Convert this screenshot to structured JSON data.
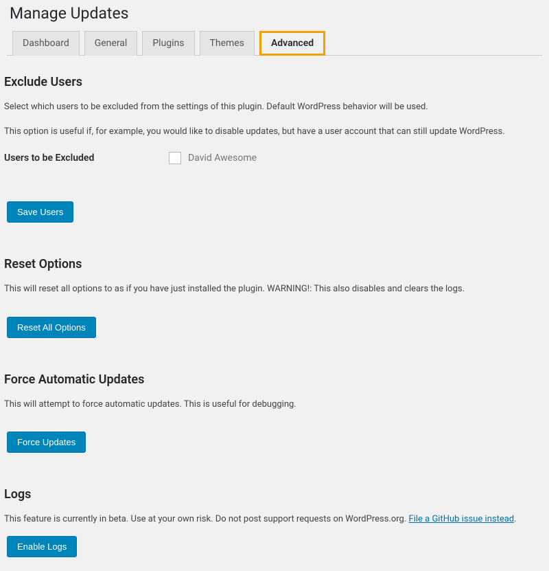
{
  "pageTitle": "Manage Updates",
  "tabs": [
    {
      "label": "Dashboard"
    },
    {
      "label": "General"
    },
    {
      "label": "Plugins"
    },
    {
      "label": "Themes"
    },
    {
      "label": "Advanced"
    }
  ],
  "excludeUsers": {
    "heading": "Exclude Users",
    "desc1": "Select which users to be excluded from the settings of this plugin. Default WordPress behavior will be used.",
    "desc2": "This option is useful if, for example, you would like to disable updates, but have a user account that can still update WordPress.",
    "formLabel": "Users to be Excluded",
    "user1": "David Awesome",
    "button": "Save Users"
  },
  "resetOptions": {
    "heading": "Reset Options",
    "desc": "This will reset all options to as if you have just installed the plugin. WARNING!: This also disables and clears the logs.",
    "button": "Reset All Options"
  },
  "forceUpdates": {
    "heading": "Force Automatic Updates",
    "desc": "This will attempt to force automatic updates. This is useful for debugging.",
    "button": "Force Updates"
  },
  "logs": {
    "heading": "Logs",
    "desc": "This feature is currently in beta. Use at your own risk. Do not post support requests on WordPress.org. ",
    "link": "File a GitHub issue instead",
    "period": ".",
    "button": "Enable Logs"
  }
}
